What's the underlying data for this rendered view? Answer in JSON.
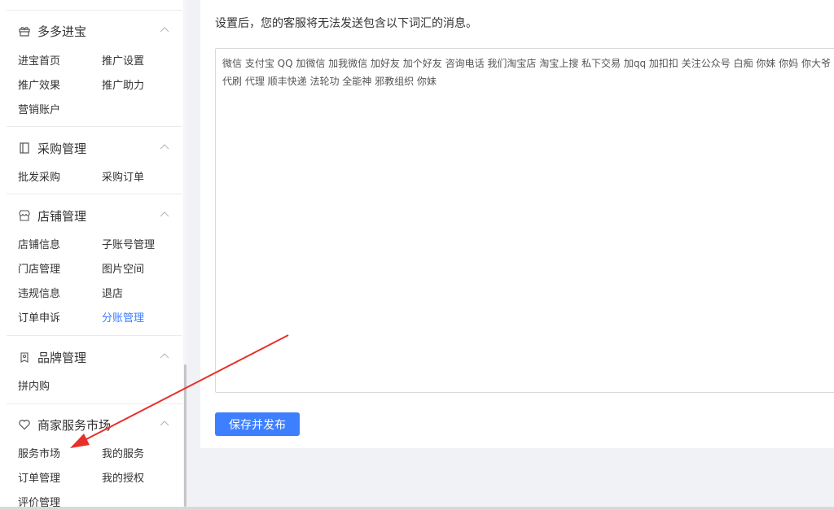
{
  "sidebar": {
    "sections": [
      {
        "title": "多多进宝",
        "icon": "gift-icon",
        "items": [
          "进宝首页",
          "推广设置",
          "推广效果",
          "推广助力",
          "营销账户"
        ]
      },
      {
        "title": "采购管理",
        "icon": "document-icon",
        "items": [
          "批发采购",
          "采购订单"
        ]
      },
      {
        "title": "店铺管理",
        "icon": "store-icon",
        "items": [
          "店铺信息",
          "子账号管理",
          "门店管理",
          "图片空间",
          "违规信息",
          "退店",
          "订单申诉",
          "分账管理"
        ]
      },
      {
        "title": "品牌管理",
        "icon": "brand-tag-icon",
        "items": [
          "拼内购"
        ]
      },
      {
        "title": "商家服务市场",
        "icon": "heart-icon",
        "items": [
          "服务市场",
          "我的服务",
          "订单管理",
          "我的授权",
          "评价管理"
        ]
      }
    ]
  },
  "main": {
    "hint": "设置后，您的客服将无法发送包含以下词汇的消息。",
    "editor_text": "微信 支付宝 QQ 加微信 加我微信 加好友 加个好友 咨询电话 我们淘宝店 淘宝上搜 私下交易 加qq 加扣扣 关注公众号 白痴 你妹 你妈 你大爷 代刷 代理 顺丰快递 法轮功 全能神 邪教组织 你妹",
    "save_label": "保存并发布"
  },
  "colors": {
    "accent": "#3d7fff",
    "annotation_arrow": "#e8302a"
  }
}
